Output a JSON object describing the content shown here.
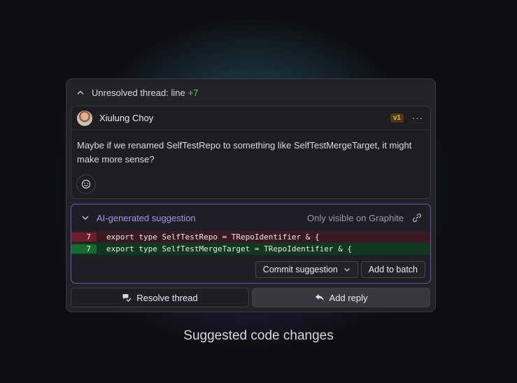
{
  "thread": {
    "header_prefix": "Unresolved thread: line",
    "line_delta": "+7"
  },
  "comment": {
    "author": "Xiulung Choy",
    "version_badge": "v1",
    "more_label": "···",
    "body": "Maybe if we renamed SelfTestRepo to something like SelfTestMergeTarget, it might make more sense?"
  },
  "suggestion": {
    "title": "AI-generated suggestion",
    "visibility": "Only visible on Graphite",
    "diff": [
      {
        "type": "removed",
        "line": "7",
        "code": "export type SelfTestRepo = TRepoIdentifier & {"
      },
      {
        "type": "added",
        "line": "7",
        "code": "export type SelfTestMergeTarget = TRepoIdentifier & {"
      }
    ],
    "commit_label": "Commit suggestion",
    "batch_label": "Add to batch"
  },
  "actions": {
    "resolve_label": "Resolve thread",
    "reply_label": "Add reply"
  },
  "caption": "Suggested code changes",
  "colors": {
    "accent_purple": "#a592ee",
    "added_green": "#5ec46d",
    "badge_orange": "#f0b23a"
  }
}
